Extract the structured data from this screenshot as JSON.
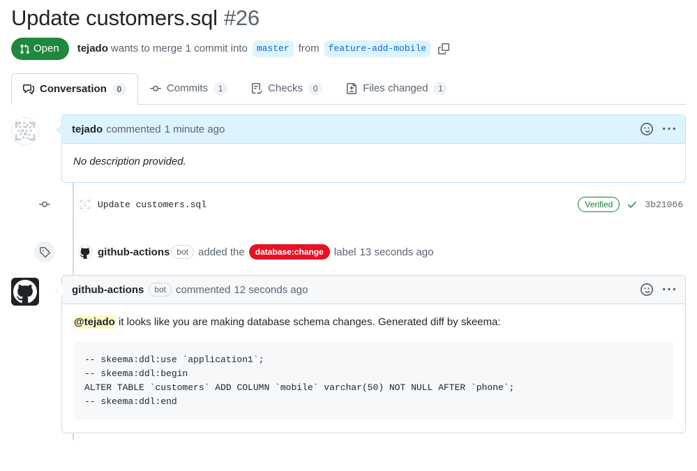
{
  "pr": {
    "title": "Update customers.sql",
    "number": "#26",
    "state_label": "Open",
    "state_color": "#1f883d",
    "author": "tejado",
    "merge_text_1": "wants to merge 1 commit into",
    "base_branch": "master",
    "merge_text_2": "from",
    "head_branch": "feature-add-mobile",
    "copy_icon": "copy-icon"
  },
  "tabs": [
    {
      "label": "Conversation",
      "count": "0",
      "icon": "comment-discussion-icon",
      "active": true
    },
    {
      "label": "Commits",
      "count": "1",
      "icon": "git-commit-icon",
      "active": false
    },
    {
      "label": "Checks",
      "count": "0",
      "icon": "checklist-icon",
      "active": false
    },
    {
      "label": "Files changed",
      "count": "1",
      "icon": "file-diff-icon",
      "active": false
    }
  ],
  "comments": [
    {
      "author": "tejado",
      "is_bot": false,
      "action": "commented",
      "timestamp": "1 minute ago",
      "body": "No description provided.",
      "reaction_icon": "smiley-icon",
      "menu_icon": "kebab-horizontal-icon"
    },
    {
      "author": "github-actions",
      "is_bot": true,
      "bot_label": "bot",
      "action": "commented",
      "timestamp": "12 seconds ago",
      "mention": "@tejado",
      "body_text": " it looks like you are making database schema changes. Generated diff by skeema:",
      "code": "-- skeema:ddl:use `application1`;\n-- skeema:ddl:begin\nALTER TABLE `customers` ADD COLUMN `mobile` varchar(50) NOT NULL AFTER `phone`;\n-- skeema:ddl:end",
      "reaction_icon": "smiley-icon",
      "menu_icon": "kebab-horizontal-icon"
    }
  ],
  "commit_event": {
    "icon": "git-commit-icon",
    "message": "Update customers.sql",
    "verified_label": "Verified",
    "check_icon": "check-icon",
    "sha": "3b21066"
  },
  "label_event": {
    "icon": "tag-icon",
    "actor": "github-actions",
    "bot_label": "bot",
    "action_text": "added the",
    "label_name": "database:change",
    "label_color": "#e81123",
    "suffix_text": "label",
    "timestamp": "13 seconds ago"
  }
}
